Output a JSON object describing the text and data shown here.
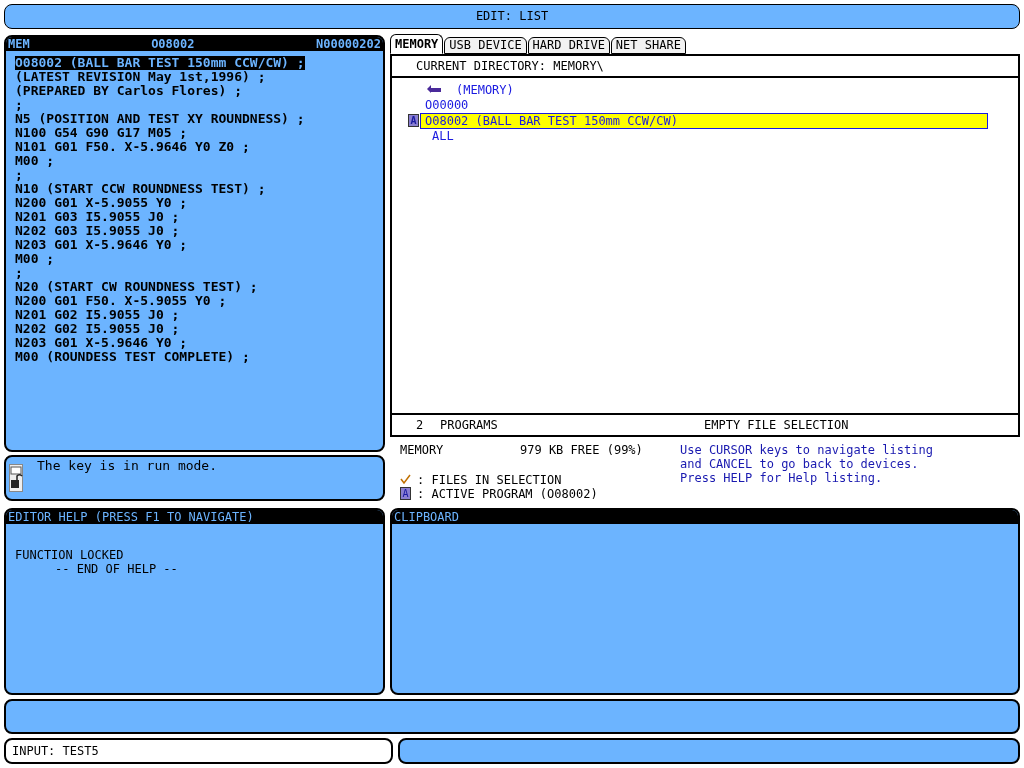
{
  "title": "EDIT: LIST",
  "program_panel": {
    "mode": "MEM",
    "program": "O08002",
    "sequence": "N00000202",
    "lines": [
      {
        "text": "O08002 (BALL BAR TEST 150mm CCW/CW) ;",
        "selected": true
      },
      {
        "text": "(LATEST REVISION May 1st,1996) ;",
        "selected": false
      },
      {
        "text": "(PREPARED BY Carlos Flores) ;",
        "selected": false
      },
      {
        "text": ";",
        "selected": false
      },
      {
        "text": "N5 (POSITION AND TEST XY ROUNDNESS) ;",
        "selected": false
      },
      {
        "text": "N100 G54 G90 G17 M05 ;",
        "selected": false
      },
      {
        "text": "N101 G01 F50. X-5.9646 Y0 Z0 ;",
        "selected": false
      },
      {
        "text": "M00 ;",
        "selected": false
      },
      {
        "text": ";",
        "selected": false
      },
      {
        "text": "N10 (START CCW ROUNDNESS TEST) ;",
        "selected": false
      },
      {
        "text": "N200 G01 X-5.9055 Y0 ;",
        "selected": false
      },
      {
        "text": "N201 G03 I5.9055 J0 ;",
        "selected": false
      },
      {
        "text": "N202 G03 I5.9055 J0 ;",
        "selected": false
      },
      {
        "text": "N203 G01 X-5.9646 Y0 ;",
        "selected": false
      },
      {
        "text": "M00 ;",
        "selected": false
      },
      {
        "text": ";",
        "selected": false
      },
      {
        "text": "N20 (START CW ROUNDNESS TEST) ;",
        "selected": false
      },
      {
        "text": "N200 G01 F50. X-5.9055 Y0 ;",
        "selected": false
      },
      {
        "text": "N201 G02 I5.9055 J0 ;",
        "selected": false
      },
      {
        "text": "N202 G02 I5.9055 J0 ;",
        "selected": false
      },
      {
        "text": "N203 G01 X-5.9646 Y0 ;",
        "selected": false
      },
      {
        "text": "M00 (ROUNDESS TEST COMPLETE) ;",
        "selected": false
      }
    ]
  },
  "key_status": {
    "message": "The key is in run mode."
  },
  "editor_help": {
    "title": "EDITOR HELP (PRESS F1 TO NAVIGATE)",
    "lines": [
      {
        "kind": "plain",
        "text": "FUNCTION LOCKED"
      },
      {
        "kind": "indented",
        "text": "-- END OF HELP --"
      }
    ]
  },
  "tabs": [
    {
      "label": "MEMORY",
      "selected": true
    },
    {
      "label": "USB DEVICE",
      "selected": false
    },
    {
      "label": "HARD DRIVE",
      "selected": false
    },
    {
      "label": "NET SHARE",
      "selected": false
    }
  ],
  "current_directory": "CURRENT DIRECTORY: MEMORY\\",
  "files": [
    {
      "kind": "parent",
      "label": "(MEMORY)"
    },
    {
      "kind": "program",
      "label": "O00000",
      "selected": false
    },
    {
      "kind": "program",
      "label": "O08002 (BALL BAR TEST 150mm CCW/CW)",
      "selected": true,
      "badge": "A"
    },
    {
      "kind": "filter",
      "label": "ALL"
    }
  ],
  "list_footer": {
    "count": "2",
    "unit": "PROGRAMS",
    "selection": "EMPTY FILE SELECTION"
  },
  "storage": {
    "device": "MEMORY",
    "free": "979 KB FREE (99%)"
  },
  "legend": [
    {
      "kind": "check",
      "text": ": FILES IN SELECTION"
    },
    {
      "kind": "active",
      "badge": "A",
      "text": ": ACTIVE PROGRAM (O08002)"
    }
  ],
  "hint_lines": [
    "Use CURSOR keys to navigate listing",
    "and CANCEL to go back to devices.",
    "Press HELP for Help listing."
  ],
  "clipboard": {
    "title": "CLIPBOARD"
  },
  "input": {
    "text": "INPUT: TEST5"
  }
}
